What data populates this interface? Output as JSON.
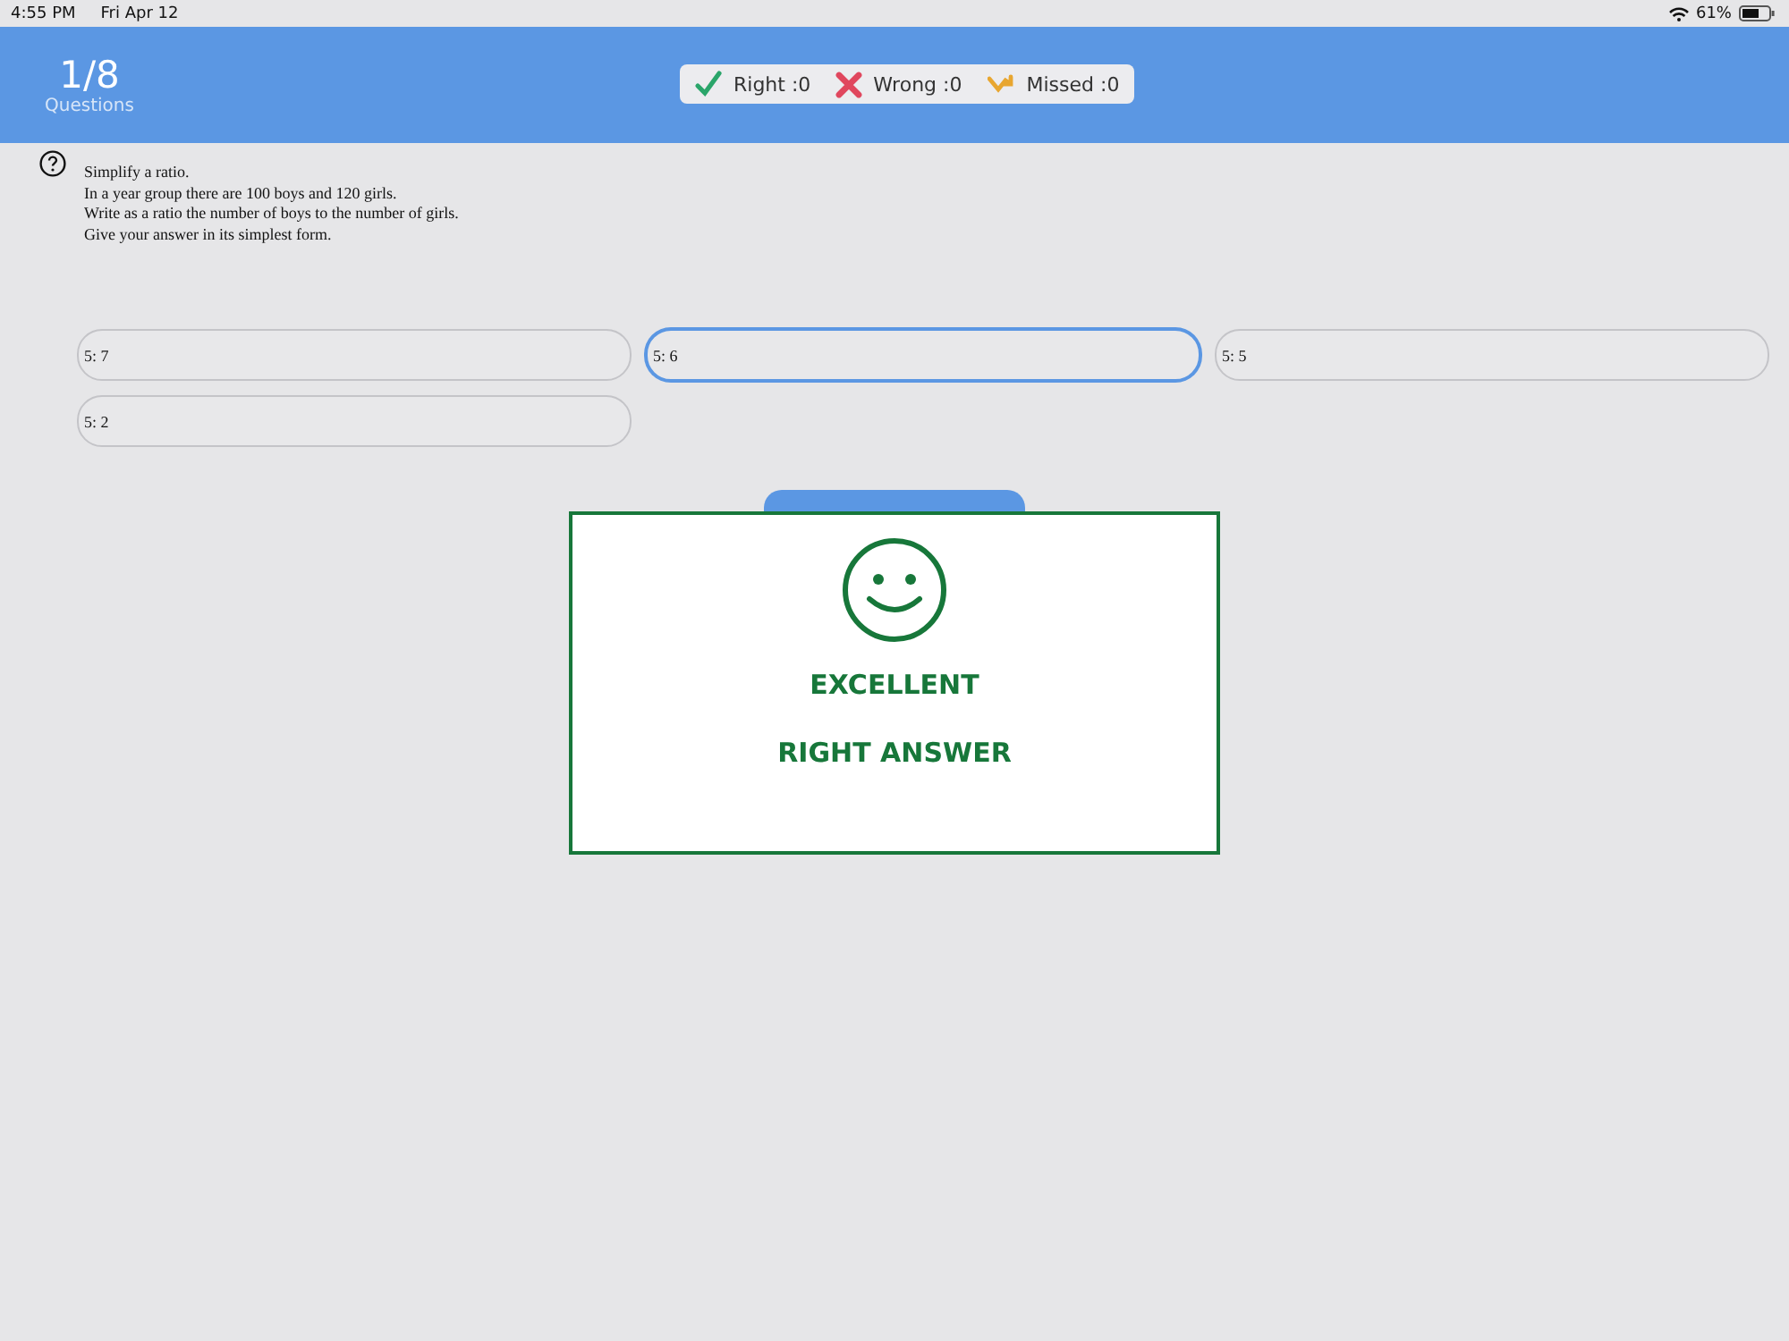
{
  "status_bar": {
    "time": "4:55 PM",
    "date": "Fri Apr 12",
    "battery": "61%"
  },
  "header": {
    "progress": "1/8",
    "progress_label": "Questions",
    "scores": [
      {
        "kind": "right",
        "label": "Right :0"
      },
      {
        "kind": "wrong",
        "label": "Wrong :0"
      },
      {
        "kind": "missed",
        "label": "Missed :0"
      }
    ]
  },
  "question": {
    "lines": [
      "Simplify a ratio.",
      "In a year group there are 100 boys and 120 girls.",
      "Write as a ratio the number of boys to the number of girls.",
      "Give your answer in its simplest form."
    ]
  },
  "options": [
    {
      "label": "5: 7",
      "selected": false
    },
    {
      "label": "5: 6",
      "selected": true
    },
    {
      "label": "5: 5",
      "selected": false
    },
    {
      "label": "5: 2",
      "selected": false
    }
  ],
  "result": {
    "title": "EXCELLENT",
    "message": "RIGHT ANSWER"
  }
}
